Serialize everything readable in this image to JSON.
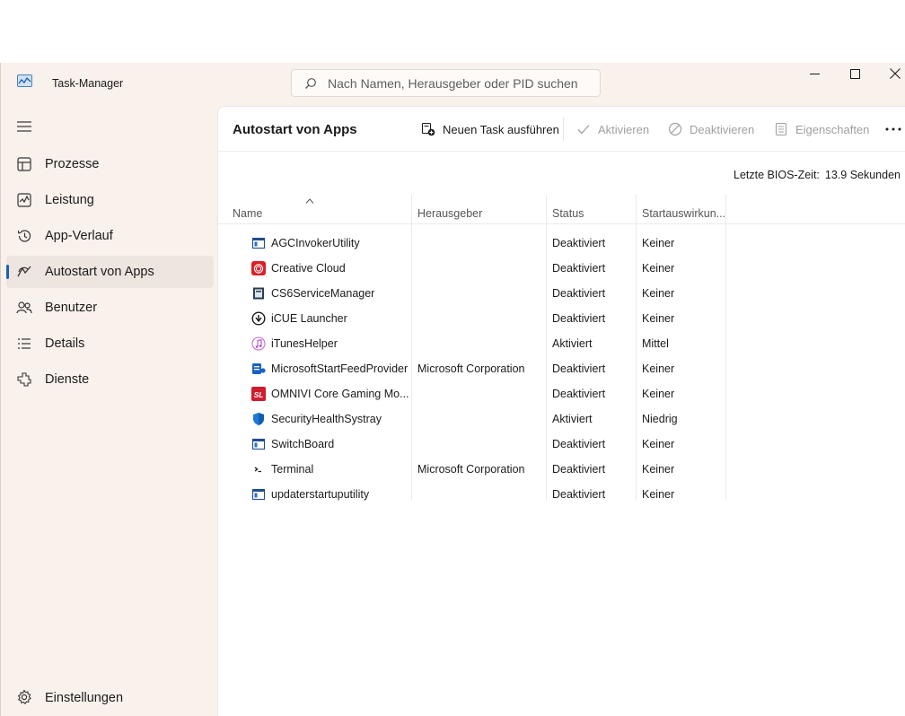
{
  "window": {
    "title": "Task-Manager",
    "search_placeholder": "Nach Namen, Herausgeber oder PID suchen"
  },
  "sidebar": {
    "items": [
      {
        "label": "Prozesse",
        "icon": "processes-icon"
      },
      {
        "label": "Leistung",
        "icon": "performance-icon"
      },
      {
        "label": "App-Verlauf",
        "icon": "history-icon"
      },
      {
        "label": "Autostart von Apps",
        "icon": "startup-icon",
        "active": true
      },
      {
        "label": "Benutzer",
        "icon": "users-icon"
      },
      {
        "label": "Details",
        "icon": "details-icon"
      },
      {
        "label": "Dienste",
        "icon": "services-icon"
      }
    ],
    "settings_label": "Einstellungen"
  },
  "toolbar": {
    "title": "Autostart von Apps",
    "run_task": "Neuen Task ausführen",
    "enable": "Aktivieren",
    "disable": "Deaktivieren",
    "properties": "Eigenschaften"
  },
  "bios": {
    "label": "Letzte BIOS-Zeit:",
    "value": "13.9 Sekunden"
  },
  "table": {
    "columns": [
      "Name",
      "Herausgeber",
      "Status",
      "Startauswirkun..."
    ],
    "rows": [
      {
        "name": "AGCInvokerUtility",
        "publisher": "",
        "status": "Deaktiviert",
        "impact": "Keiner",
        "icon": "generic-app-icon"
      },
      {
        "name": "Creative Cloud",
        "publisher": "",
        "status": "Deaktiviert",
        "impact": "Keiner",
        "icon": "creative-cloud-icon"
      },
      {
        "name": "CS6ServiceManager",
        "publisher": "",
        "status": "Deaktiviert",
        "impact": "Keiner",
        "icon": "service-manager-icon"
      },
      {
        "name": "iCUE Launcher",
        "publisher": "",
        "status": "Deaktiviert",
        "impact": "Keiner",
        "icon": "icue-icon"
      },
      {
        "name": "iTunesHelper",
        "publisher": "",
        "status": "Aktiviert",
        "impact": "Mittel",
        "icon": "itunes-icon"
      },
      {
        "name": "MicrosoftStartFeedProvider",
        "publisher": "Microsoft Corporation",
        "status": "Deaktiviert",
        "impact": "Keiner",
        "icon": "microsoft-start-icon"
      },
      {
        "name": "OMNIVI Core Gaming Mo...",
        "publisher": "",
        "status": "Deaktiviert",
        "impact": "Keiner",
        "icon": "omnivi-icon"
      },
      {
        "name": "SecurityHealthSystray",
        "publisher": "",
        "status": "Aktiviert",
        "impact": "Niedrig",
        "icon": "security-shield-icon"
      },
      {
        "name": "SwitchBoard",
        "publisher": "",
        "status": "Deaktiviert",
        "impact": "Keiner",
        "icon": "generic-app-icon"
      },
      {
        "name": "Terminal",
        "publisher": "Microsoft Corporation",
        "status": "Deaktiviert",
        "impact": "Keiner",
        "icon": "terminal-icon"
      },
      {
        "name": "updaterstartuputility",
        "publisher": "",
        "status": "Deaktiviert",
        "impact": "Keiner",
        "icon": "generic-app-icon"
      }
    ]
  },
  "colors": {
    "window_bg": "#f9f1ec",
    "accent": "#1a5fb4",
    "disabled_text": "#a0a0a0"
  }
}
